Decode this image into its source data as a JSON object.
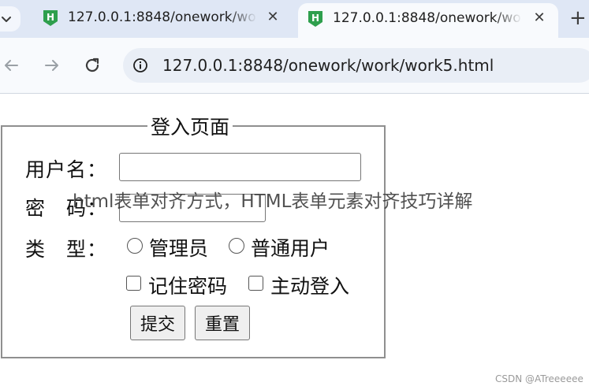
{
  "browser": {
    "tabs": [
      {
        "title": "127.0.0.1:8848/onework/work/work5.html",
        "close": "✕",
        "active": false
      },
      {
        "title": "127.0.0.1:8848/onework/work/work5.html",
        "close": "✕",
        "active": true
      }
    ],
    "new_tab": "+",
    "address": "127.0.0.1:8848/onework/work/work5.html",
    "favicon_color": "#2e9f4d",
    "accent": "#dfe7f5"
  },
  "form": {
    "legend": "登入页面",
    "username_label": "用户名：",
    "username_value": "",
    "password_label": "密　码：",
    "password_value": "",
    "type_label": "类　型：",
    "radio_options": [
      "管理员",
      "普通用户"
    ],
    "checkbox_options": [
      "记住密码",
      "主动登入"
    ],
    "submit_label": "提交",
    "reset_label": "重置"
  },
  "overlay_title": "html表单对齐方式，HTML表单元素对齐技巧详解",
  "watermark": "CSDN @ATreeeeee"
}
